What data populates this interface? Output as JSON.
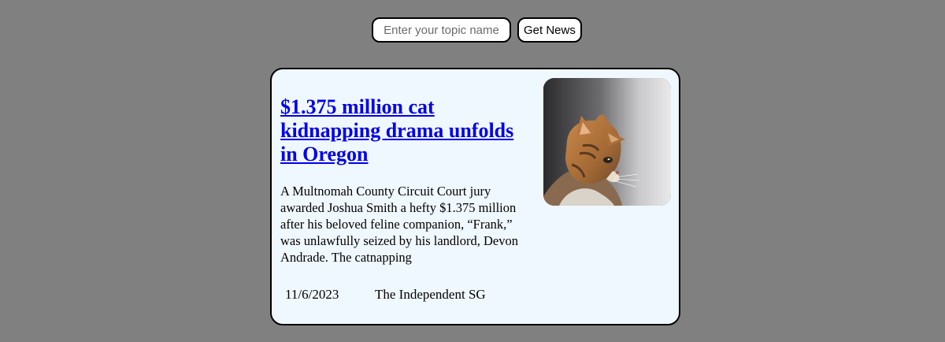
{
  "search": {
    "placeholder": "Enter your topic name",
    "button_label": "Get News"
  },
  "article": {
    "headline": "$1.375 million cat kidnapping drama unfolds in Oregon",
    "summary": "A Multnomah County Circuit Court jury awarded Joshua Smith a hefty $1.375 million after his beloved feline companion, “Frank,” was unlawfully seized by his landlord, Devon Andrade. The catnapping",
    "date": "11/6/2023",
    "source": "The Independent SG",
    "image_subject": "cat-photo"
  },
  "colors": {
    "page_background": "#808080",
    "card_background": "#f0f8ff",
    "link": "#0000ee"
  }
}
